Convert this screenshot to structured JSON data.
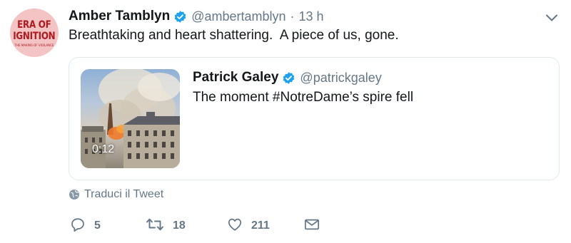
{
  "tweet": {
    "avatar": {
      "line1": "ERA OF",
      "line2": "IGNITION",
      "line3": "THE MAKING OF VIGILANCE"
    },
    "author_name": "Amber Tamblyn",
    "handle": "@ambertamblyn",
    "separator": "·",
    "timestamp": "13 h",
    "text": "Breathtaking and heart shattering.  A piece of us, gone.",
    "quoted": {
      "author_name": "Patrick Galey",
      "handle": "@patrickgaley",
      "text": "The moment #NotreDame’s spire fell",
      "video_duration": "0:12"
    },
    "translate_label": "Traduci il Tweet",
    "actions": {
      "replies": "5",
      "retweets": "18",
      "likes": "211"
    }
  },
  "colors": {
    "verified": "#1da1f2",
    "secondary_text": "#657786",
    "border": "#e1e8ed",
    "avatar_bg": "#f4c3c4",
    "avatar_text": "#b0191e"
  },
  "icons": {
    "verified": "verified-badge-icon",
    "caret": "chevron-down-icon",
    "globe": "globe-icon",
    "reply": "reply-icon",
    "retweet": "retweet-icon",
    "like": "heart-icon",
    "dm": "envelope-icon"
  }
}
